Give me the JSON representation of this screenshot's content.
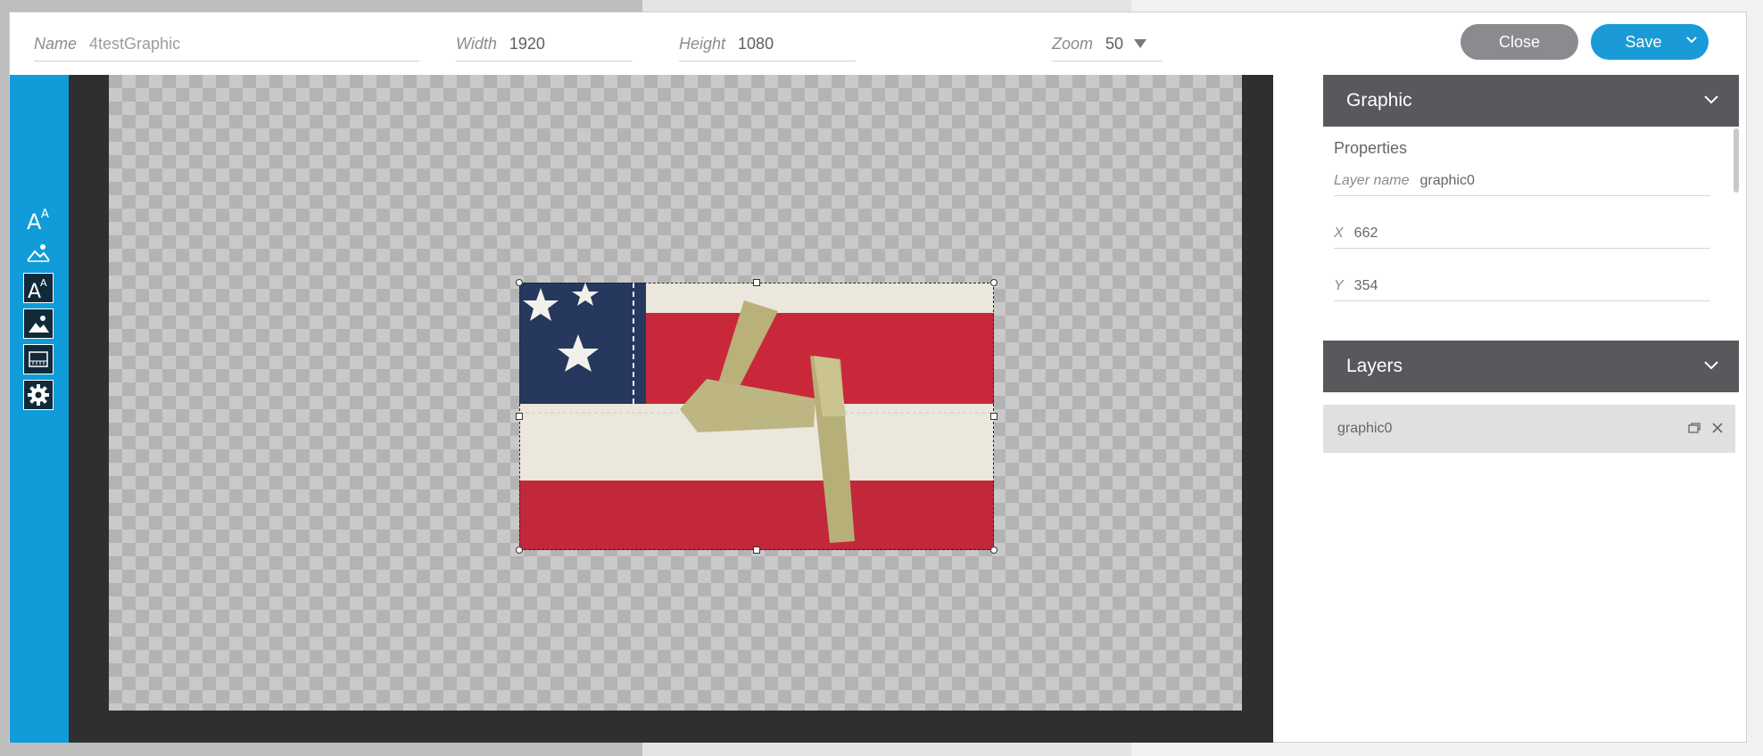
{
  "header": {
    "name_label": "Name",
    "name_value": "4testGraphic",
    "width_label": "Width",
    "width_value": "1920",
    "height_label": "Height",
    "height_value": "1080",
    "zoom_label": "Zoom",
    "zoom_value": "50"
  },
  "buttons": {
    "close_label": "Close",
    "save_label": "Save"
  },
  "tools": [
    {
      "icon": "add-text-icon"
    },
    {
      "icon": "add-image-icon"
    },
    {
      "icon": "text-layer-icon"
    },
    {
      "icon": "image-layer-icon"
    },
    {
      "icon": "ruler-icon"
    },
    {
      "icon": "settings-gear-icon"
    }
  ],
  "graphic_panel": {
    "title": "Graphic",
    "properties_title": "Properties",
    "layer_name_label": "Layer name",
    "layer_name_value": "graphic0",
    "x_label": "X",
    "x_value": "662",
    "y_label": "Y",
    "y_value": "354"
  },
  "layers_panel": {
    "title": "Layers",
    "items": [
      {
        "name": "graphic0"
      }
    ]
  },
  "colors": {
    "accent_blue": "#1a9bd8",
    "sidebar_blue": "#0f9cd8",
    "panel_header": "#58585d",
    "close_button": "#8a8a8f"
  }
}
